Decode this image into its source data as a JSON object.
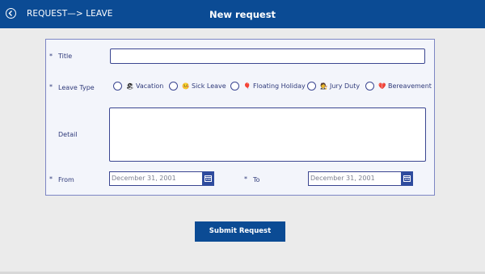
{
  "header": {
    "breadcrumb": "REQUEST—> LEAVE",
    "title": "New request"
  },
  "form": {
    "title": {
      "required_mark": "*",
      "label": "Title",
      "value": ""
    },
    "leave_type": {
      "required_mark": "*",
      "label": "Leave Type",
      "options": [
        {
          "emoji": "🏖",
          "label": "Vacation",
          "selected": false
        },
        {
          "emoji": "🤒",
          "label": "Sick Leave",
          "selected": false
        },
        {
          "emoji": "🎈",
          "label": "Floating Holiday",
          "selected": false
        },
        {
          "emoji": "🧑‍⚖️",
          "label": "Jury Duty",
          "selected": false
        },
        {
          "emoji": "💔",
          "label": "Bereavement",
          "selected": false
        }
      ]
    },
    "detail": {
      "label": "Detail",
      "value": ""
    },
    "from": {
      "required_mark": "*",
      "label": "From",
      "placeholder": "December 31, 2001"
    },
    "to": {
      "required_mark": "*",
      "label": "To",
      "placeholder": "December 31, 2001"
    }
  },
  "submit": {
    "label": "Submit Request"
  },
  "colors": {
    "brand": "#0b4b94",
    "accent_border": "#3b4691",
    "panel_bg": "#f3f5fb"
  },
  "icons": {
    "back": "arrow-left-circle-icon",
    "calendar": "calendar-icon"
  }
}
